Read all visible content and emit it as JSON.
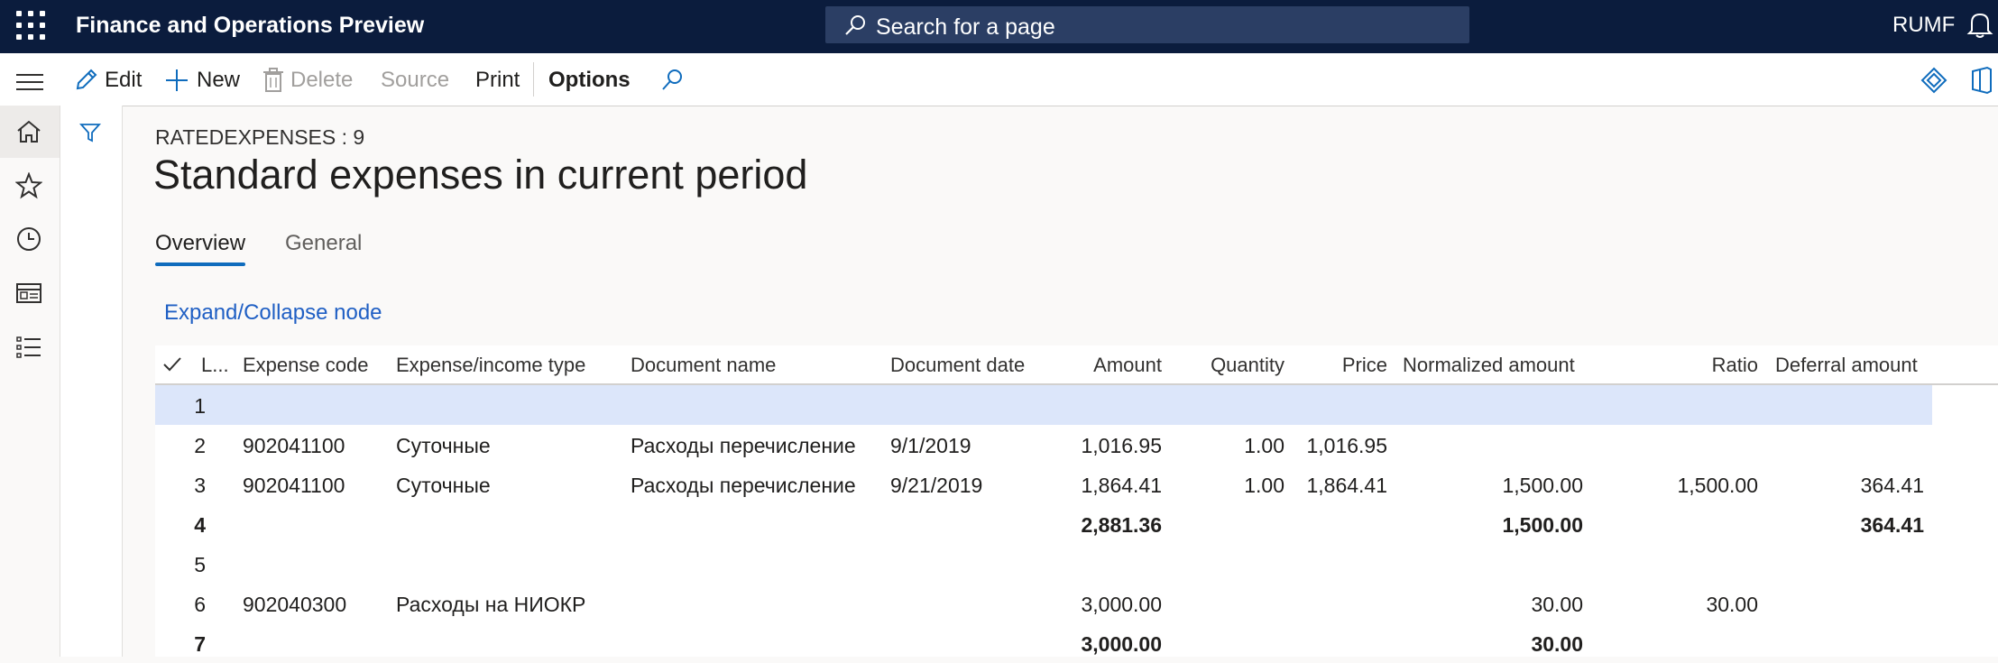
{
  "app": {
    "title": "Finance and Operations Preview",
    "company": "RUMF"
  },
  "search": {
    "placeholder": "Search for a page"
  },
  "actions": {
    "edit": "Edit",
    "new": "New",
    "delete": "Delete",
    "source": "Source",
    "print": "Print",
    "options": "Options"
  },
  "page": {
    "caption": "RATEDEXPENSES : 9",
    "title": "Standard expenses in current period"
  },
  "tabs": [
    {
      "label": "Overview",
      "active": true
    },
    {
      "label": "General",
      "active": false
    }
  ],
  "expand_link": "Expand/Collapse node",
  "grid": {
    "columns": [
      "L...",
      "Expense code",
      "Expense/income type",
      "Document name",
      "Document date",
      "Amount",
      "Quantity",
      "Price",
      "Normalized amount",
      "Ratio",
      "Deferral amount"
    ],
    "rows": [
      {
        "line": "1",
        "code": "",
        "type": "",
        "doc_name": "",
        "doc_date": "",
        "amount": "",
        "quantity": "",
        "price": "",
        "normalized": "",
        "ratio": "",
        "deferral": "",
        "selected": true,
        "bold": false
      },
      {
        "line": "2",
        "code": "902041100",
        "type": "Суточные",
        "doc_name": "Расходы перечисление",
        "doc_date": "9/1/2019",
        "amount": "1,016.95",
        "quantity": "1.00",
        "price": "1,016.95",
        "normalized": "",
        "ratio": "",
        "deferral": "",
        "selected": false,
        "bold": false
      },
      {
        "line": "3",
        "code": "902041100",
        "type": "Суточные",
        "doc_name": "Расходы перечисление",
        "doc_date": "9/21/2019",
        "amount": "1,864.41",
        "quantity": "1.00",
        "price": "1,864.41",
        "normalized": "1,500.00",
        "ratio": "1,500.00",
        "deferral": "364.41",
        "selected": false,
        "bold": false
      },
      {
        "line": "4",
        "code": "",
        "type": "",
        "doc_name": "",
        "doc_date": "",
        "amount": "2,881.36",
        "quantity": "",
        "price": "",
        "normalized": "1,500.00",
        "ratio": "",
        "deferral": "364.41",
        "selected": false,
        "bold": true
      },
      {
        "line": "5",
        "code": "",
        "type": "",
        "doc_name": "",
        "doc_date": "",
        "amount": "",
        "quantity": "",
        "price": "",
        "normalized": "",
        "ratio": "",
        "deferral": "",
        "selected": false,
        "bold": false
      },
      {
        "line": "6",
        "code": "902040300",
        "type": "Расходы на НИОКР",
        "doc_name": "",
        "doc_date": "",
        "amount": "3,000.00",
        "quantity": "",
        "price": "",
        "normalized": "30.00",
        "ratio": "30.00",
        "deferral": "",
        "selected": false,
        "bold": false
      },
      {
        "line": "7",
        "code": "",
        "type": "",
        "doc_name": "",
        "doc_date": "",
        "amount": "3,000.00",
        "quantity": "",
        "price": "",
        "normalized": "30.00",
        "ratio": "",
        "deferral": "",
        "selected": false,
        "bold": true
      }
    ]
  }
}
